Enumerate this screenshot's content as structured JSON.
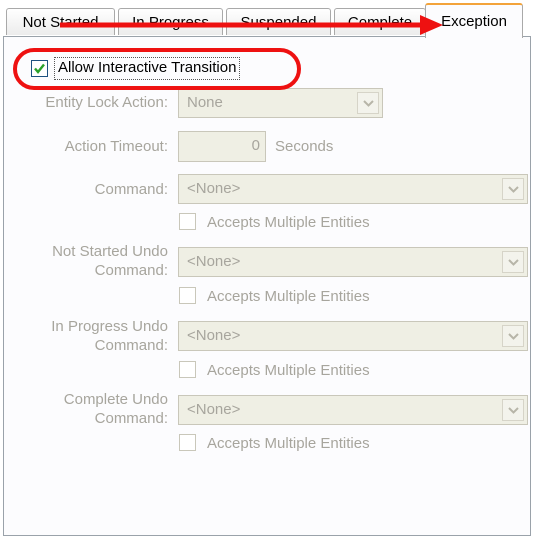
{
  "tabs": [
    {
      "label": "Not Started"
    },
    {
      "label": "In Progress"
    },
    {
      "label": "Suspended"
    },
    {
      "label": "Complete"
    },
    {
      "label": "Exception"
    }
  ],
  "allow_interactive": {
    "label": "Allow Interactive Transition",
    "checked": true
  },
  "entity_lock": {
    "label": "Entity Lock Action:",
    "value": "None"
  },
  "action_timeout": {
    "label": "Action Timeout:",
    "value": "0",
    "unit": "Seconds"
  },
  "command": {
    "label": "Command:",
    "value": "<None>",
    "checkbox_label": "Accepts Multiple Entities"
  },
  "not_started_undo": {
    "label_line1": "Not Started Undo",
    "label_line2": "Command:",
    "value": "<None>",
    "checkbox_label": "Accepts Multiple Entities"
  },
  "in_progress_undo": {
    "label_line1": "In Progress Undo",
    "label_line2": "Command:",
    "value": "<None>",
    "checkbox_label": "Accepts Multiple Entities"
  },
  "complete_undo": {
    "label_line1": "Complete Undo",
    "label_line2": "Command:",
    "value": "<None>",
    "checkbox_label": "Accepts Multiple Entities"
  },
  "colors": {
    "annotation": "#ee1111",
    "active_tab_accent": "#f3a33a",
    "disabled_text": "#a7a59d"
  }
}
